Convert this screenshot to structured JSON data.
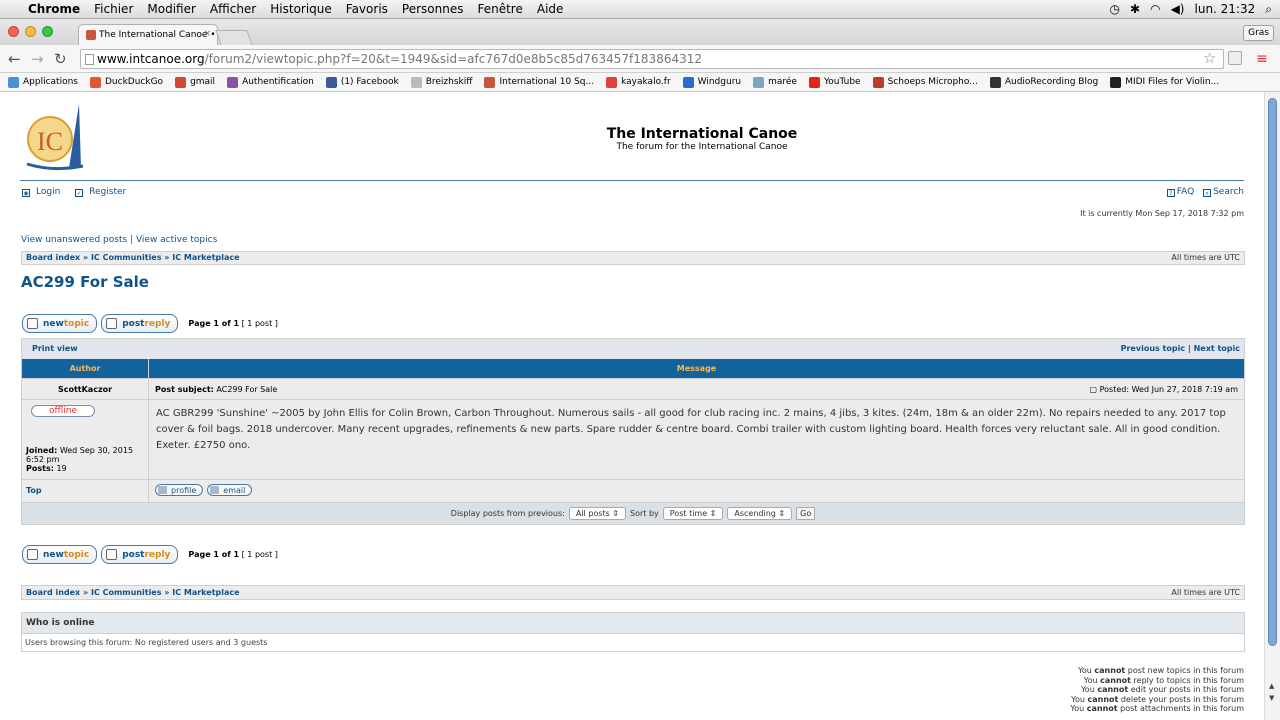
{
  "os_menubar": {
    "app": "Chrome",
    "items": [
      "Fichier",
      "Modifier",
      "Afficher",
      "Historique",
      "Favoris",
      "Personnes",
      "Fenêtre",
      "Aide"
    ],
    "clock": "lun. 21:32"
  },
  "browser": {
    "tab_title": "The International Canoe •",
    "user_button": "Gras",
    "url_host": "www.intcanoe.org",
    "url_path": "/forum2/viewtopic.php?f=20&t=1949&sid=afc767d0e8b5c85d763457f183864312",
    "bookmarks": [
      {
        "label": "Applications",
        "color": "#4a90d9"
      },
      {
        "label": "DuckDuckGo",
        "color": "#de5833"
      },
      {
        "label": "gmail",
        "color": "#d44638"
      },
      {
        "label": "Authentification",
        "color": "#8a4fa6"
      },
      {
        "label": "(1) Facebook",
        "color": "#3b5998"
      },
      {
        "label": "Breizhskiff",
        "color": "#bbbbbb"
      },
      {
        "label": "International 10 Sq...",
        "color": "#c9553a"
      },
      {
        "label": "kayakalo.fr",
        "color": "#e04040"
      },
      {
        "label": "Windguru",
        "color": "#2a6bd1"
      },
      {
        "label": "marée",
        "color": "#7aa6c2"
      },
      {
        "label": "YouTube",
        "color": "#e62117"
      },
      {
        "label": "Schoeps Micropho...",
        "color": "#c0392b"
      },
      {
        "label": "AudioRecording Blog",
        "color": "#333333"
      },
      {
        "label": "MIDI Files for Violin...",
        "color": "#222222"
      }
    ]
  },
  "site": {
    "title": "The International Canoe",
    "subtitle": "The forum for the International Canoe",
    "login": "Login",
    "register": "Register",
    "faq": "FAQ",
    "search": "Search",
    "current_time": "It is currently Mon Sep 17, 2018 7:32 pm",
    "unanswered": "View unanswered posts",
    "active": "View active topics",
    "crumbs": "Board index » IC Communities » IC Marketplace",
    "timezone": "All times are UTC"
  },
  "topic": {
    "title": "AC299 For Sale",
    "new_topic_a": "new",
    "new_topic_b": "topic",
    "post_reply_a": "post",
    "post_reply_b": "reply",
    "page_label": "Page 1 of 1",
    "post_count": "[ 1 post ]",
    "print_view": "Print view",
    "prev_next": "Previous topic | Next topic",
    "col_author": "Author",
    "col_message": "Message",
    "author": "ScottKaczor",
    "subject_label": "Post subject:",
    "subject": "AC299 For Sale",
    "posted": "Posted: Wed Jun 27, 2018 7:19 am",
    "status": "offline",
    "joined_label": "Joined:",
    "joined_value": "Wed Sep 30, 2015 6:52 pm",
    "posts_label": "Posts:",
    "posts_value": "19",
    "body": "AC GBR299 'Sunshine' ~2005 by John Ellis for Colin Brown, Carbon Throughout. Numerous sails - all good for club racing inc. 2 mains, 4 jibs, 3 kites. (24m, 18m & an older 22m). No repairs needed to any. 2017 top cover & foil bags. 2018 undercover. Many recent upgrades, refinements & new parts. Spare rudder & centre board. Combi trailer with custom lighting board. Health forces very reluctant sale. All in good condition. Exeter. £2750 ono.",
    "top": "Top",
    "profile": "profile",
    "email": "email",
    "display_label": "Display posts from previous:",
    "display_value": "All posts",
    "sort_label": "Sort by",
    "sort_value": "Post time",
    "order_value": "Ascending",
    "go": "Go"
  },
  "online": {
    "title": "Who is online",
    "text": "Users browsing this forum: No registered users and 3 guests"
  },
  "permissions": [
    {
      "pre": "You ",
      "bold": "cannot",
      "post": " post new topics in this forum"
    },
    {
      "pre": "You ",
      "bold": "cannot",
      "post": " reply to topics in this forum"
    },
    {
      "pre": "You ",
      "bold": "cannot",
      "post": " edit your posts in this forum"
    },
    {
      "pre": "You ",
      "bold": "cannot",
      "post": " delete your posts in this forum"
    },
    {
      "pre": "You ",
      "bold": "cannot",
      "post": " post attachments in this forum"
    }
  ]
}
